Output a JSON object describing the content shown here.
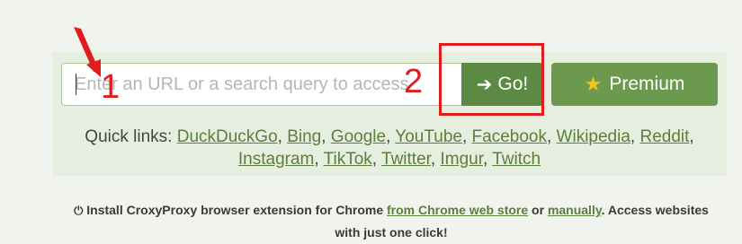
{
  "search": {
    "placeholder": "Enter an URL or a search query to access",
    "value": ""
  },
  "go_button": {
    "label": "Go!",
    "icon": "arrow-right-icon"
  },
  "premium_button": {
    "label": "Premium",
    "icon": "star-icon"
  },
  "quick_links": {
    "label": "Quick links:",
    "items": [
      "DuckDuckGo",
      "Bing",
      "Google",
      "YouTube",
      "Facebook",
      "Wikipedia",
      "Reddit",
      "Instagram",
      "TikTok",
      "Twitter",
      "Imgur",
      "Twitch"
    ]
  },
  "install": {
    "icon": "plug-icon",
    "text_1": "Install CroxyProxy browser extension for Chrome",
    "link_1": "from Chrome web store",
    "text_2": "or",
    "link_2": "manually",
    "text_3": ". Access websites with just one click!"
  },
  "annotations": {
    "marker_1": "1",
    "marker_2": "2"
  },
  "colors": {
    "accent_green": "#5c8a44",
    "link_green": "#5a7f3d",
    "annotation_red": "#e11c1c"
  }
}
